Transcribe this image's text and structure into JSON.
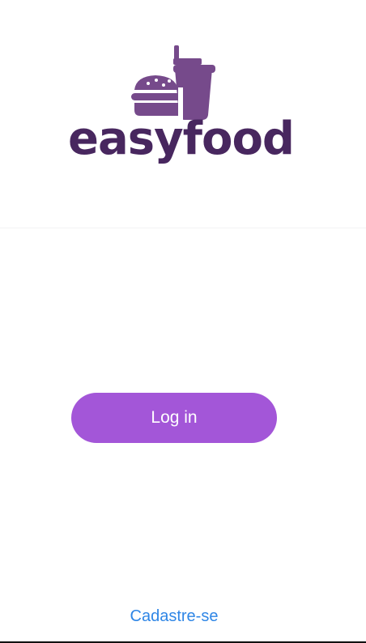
{
  "brand": {
    "name": "easyfood",
    "icon": "burger-and-drink-icon",
    "color": "#48275f"
  },
  "actions": {
    "login_label": "Log in",
    "login_color": "#a356d8",
    "signup_label": "Cadastre-se",
    "signup_color": "#2f86e6"
  }
}
